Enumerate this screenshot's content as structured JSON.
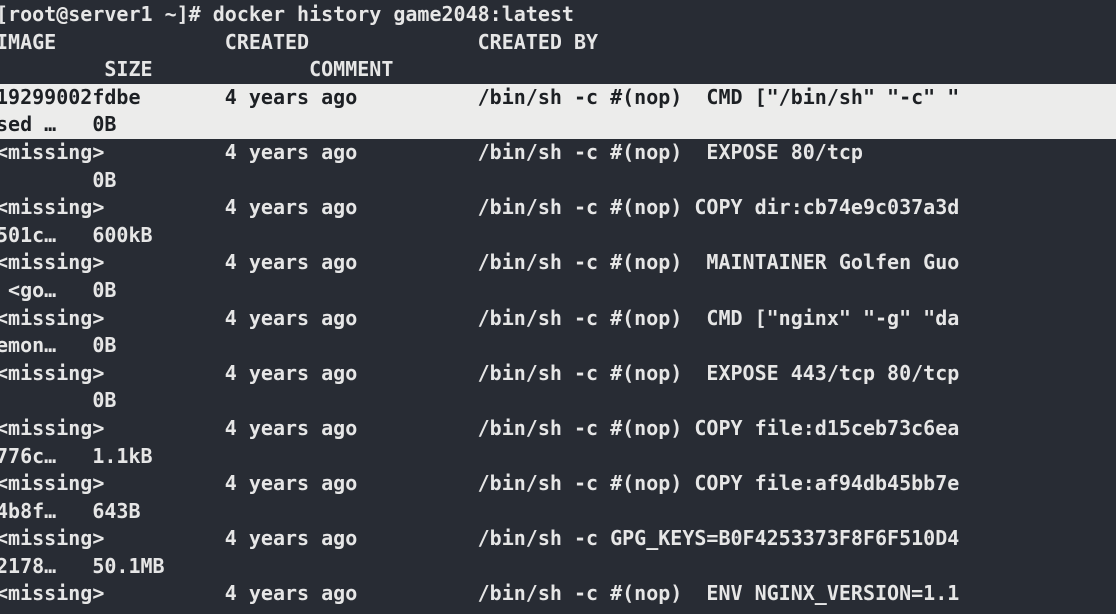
{
  "terminal": {
    "title": "docker history game2048:latest",
    "colors": {
      "background": "#282c34",
      "foreground": "#e6e6e6",
      "highlight_background": "#ececeb",
      "highlight_foreground": "#1d2024"
    },
    "prompt": {
      "user": "root",
      "host": "server1",
      "cwd": "~",
      "symbol": "#",
      "full": "[root@server1 ~]#",
      "command": "docker history game2048:latest"
    },
    "columns": {
      "image": "IMAGE",
      "created": "CREATED",
      "created_by": "CREATED BY",
      "size": "SIZE",
      "comment": "COMMENT"
    },
    "lines": [
      {
        "text": "[root@server1 ~]# docker history game2048:latest",
        "inverse": false
      },
      {
        "text": "IMAGE              CREATED              CREATED BY",
        "inverse": false
      },
      {
        "text": "         SIZE             COMMENT",
        "inverse": false
      },
      {
        "text": "19299002fdbe       4 years ago          /bin/sh -c #(nop)  CMD [\"/bin/sh\" \"-c\" \"",
        "inverse": true
      },
      {
        "text": "sed …   0B",
        "inverse": true
      },
      {
        "text": "<missing>          4 years ago          /bin/sh -c #(nop)  EXPOSE 80/tcp",
        "inverse": false
      },
      {
        "text": "        0B",
        "inverse": false
      },
      {
        "text": "<missing>          4 years ago          /bin/sh -c #(nop) COPY dir:cb74e9c037a3d",
        "inverse": false
      },
      {
        "text": "501c…   600kB",
        "inverse": false
      },
      {
        "text": "<missing>          4 years ago          /bin/sh -c #(nop)  MAINTAINER Golfen Guo",
        "inverse": false
      },
      {
        "text": " <go…   0B",
        "inverse": false
      },
      {
        "text": "<missing>          4 years ago          /bin/sh -c #(nop)  CMD [\"nginx\" \"-g\" \"da",
        "inverse": false
      },
      {
        "text": "emon…   0B",
        "inverse": false
      },
      {
        "text": "<missing>          4 years ago          /bin/sh -c #(nop)  EXPOSE 443/tcp 80/tcp",
        "inverse": false
      },
      {
        "text": "        0B",
        "inverse": false
      },
      {
        "text": "<missing>          4 years ago          /bin/sh -c #(nop) COPY file:d15ceb73c6ea",
        "inverse": false
      },
      {
        "text": "776c…   1.1kB",
        "inverse": false
      },
      {
        "text": "<missing>          4 years ago          /bin/sh -c #(nop) COPY file:af94db45bb7e",
        "inverse": false
      },
      {
        "text": "4b8f…   643B",
        "inverse": false
      },
      {
        "text": "<missing>          4 years ago          /bin/sh -c GPG_KEYS=B0F4253373F8F6F510D4",
        "inverse": false
      },
      {
        "text": "2178…   50.1MB",
        "inverse": false
      },
      {
        "text": "<missing>          4 years ago          /bin/sh -c #(nop)  ENV NGINX_VERSION=1.1",
        "inverse": false
      }
    ],
    "history_rows": [
      {
        "image": "19299002fdbe",
        "created": "4 years ago",
        "created_by": "/bin/sh -c #(nop)  CMD [\"/bin/sh\" \"-c\" \"sed …",
        "size": "0B",
        "comment": "",
        "selected": true
      },
      {
        "image": "<missing>",
        "created": "4 years ago",
        "created_by": "/bin/sh -c #(nop)  EXPOSE 80/tcp",
        "size": "0B",
        "comment": "",
        "selected": false
      },
      {
        "image": "<missing>",
        "created": "4 years ago",
        "created_by": "/bin/sh -c #(nop) COPY dir:cb74e9c037a3d501c…",
        "size": "600kB",
        "comment": "",
        "selected": false
      },
      {
        "image": "<missing>",
        "created": "4 years ago",
        "created_by": "/bin/sh -c #(nop)  MAINTAINER Golfen Guo <go…",
        "size": "0B",
        "comment": "",
        "selected": false
      },
      {
        "image": "<missing>",
        "created": "4 years ago",
        "created_by": "/bin/sh -c #(nop)  CMD [\"nginx\" \"-g\" \"daemon…",
        "size": "0B",
        "comment": "",
        "selected": false
      },
      {
        "image": "<missing>",
        "created": "4 years ago",
        "created_by": "/bin/sh -c #(nop)  EXPOSE 443/tcp 80/tcp",
        "size": "0B",
        "comment": "",
        "selected": false
      },
      {
        "image": "<missing>",
        "created": "4 years ago",
        "created_by": "/bin/sh -c #(nop) COPY file:d15ceb73c6ea776c…",
        "size": "1.1kB",
        "comment": "",
        "selected": false
      },
      {
        "image": "<missing>",
        "created": "4 years ago",
        "created_by": "/bin/sh -c #(nop) COPY file:af94db45bb7e4b8f…",
        "size": "643B",
        "comment": "",
        "selected": false
      },
      {
        "image": "<missing>",
        "created": "4 years ago",
        "created_by": "/bin/sh -c GPG_KEYS=B0F4253373F8F6F510D42178…",
        "size": "50.1MB",
        "comment": "",
        "selected": false
      },
      {
        "image": "<missing>",
        "created": "4 years ago",
        "created_by": "/bin/sh -c #(nop)  ENV NGINX_VERSION=1.1",
        "size": "",
        "comment": "",
        "selected": false
      }
    ]
  }
}
